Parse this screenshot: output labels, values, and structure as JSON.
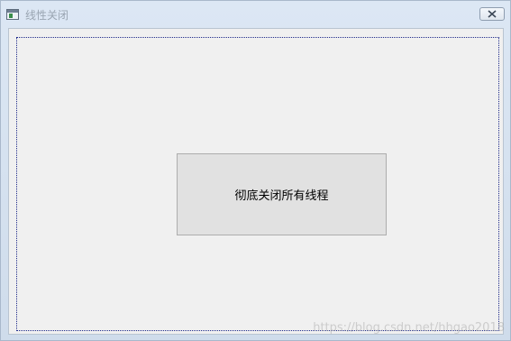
{
  "window": {
    "title": "线性关闭",
    "app_icon": "window-app-icon",
    "close_icon": "close-x-icon"
  },
  "content": {
    "main_button_label": "彻底关闭所有线程"
  },
  "watermark": {
    "text": "https://blog.csdn.net/hhgao2018"
  }
}
